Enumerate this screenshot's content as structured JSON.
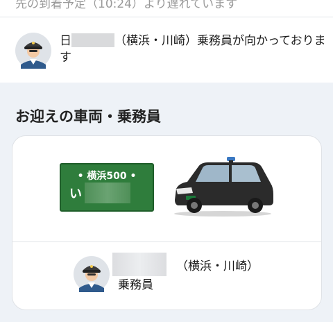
{
  "banner": {
    "prefix": "日",
    "message": "（横浜・川崎）乗務員が向かっております"
  },
  "section": {
    "title": "お迎えの車両・乗務員"
  },
  "vehicle": {
    "plate_region": "• 横浜500 •",
    "plate_kana": "い"
  },
  "driver": {
    "region": "（横浜・川崎）",
    "role": "乗務員"
  },
  "colors": {
    "plate": "#2f7d3c",
    "taxi_body": "#2b2b2b",
    "background": "#eef2f7"
  },
  "icons": [
    "driver-avatar-icon",
    "taxi-icon"
  ]
}
